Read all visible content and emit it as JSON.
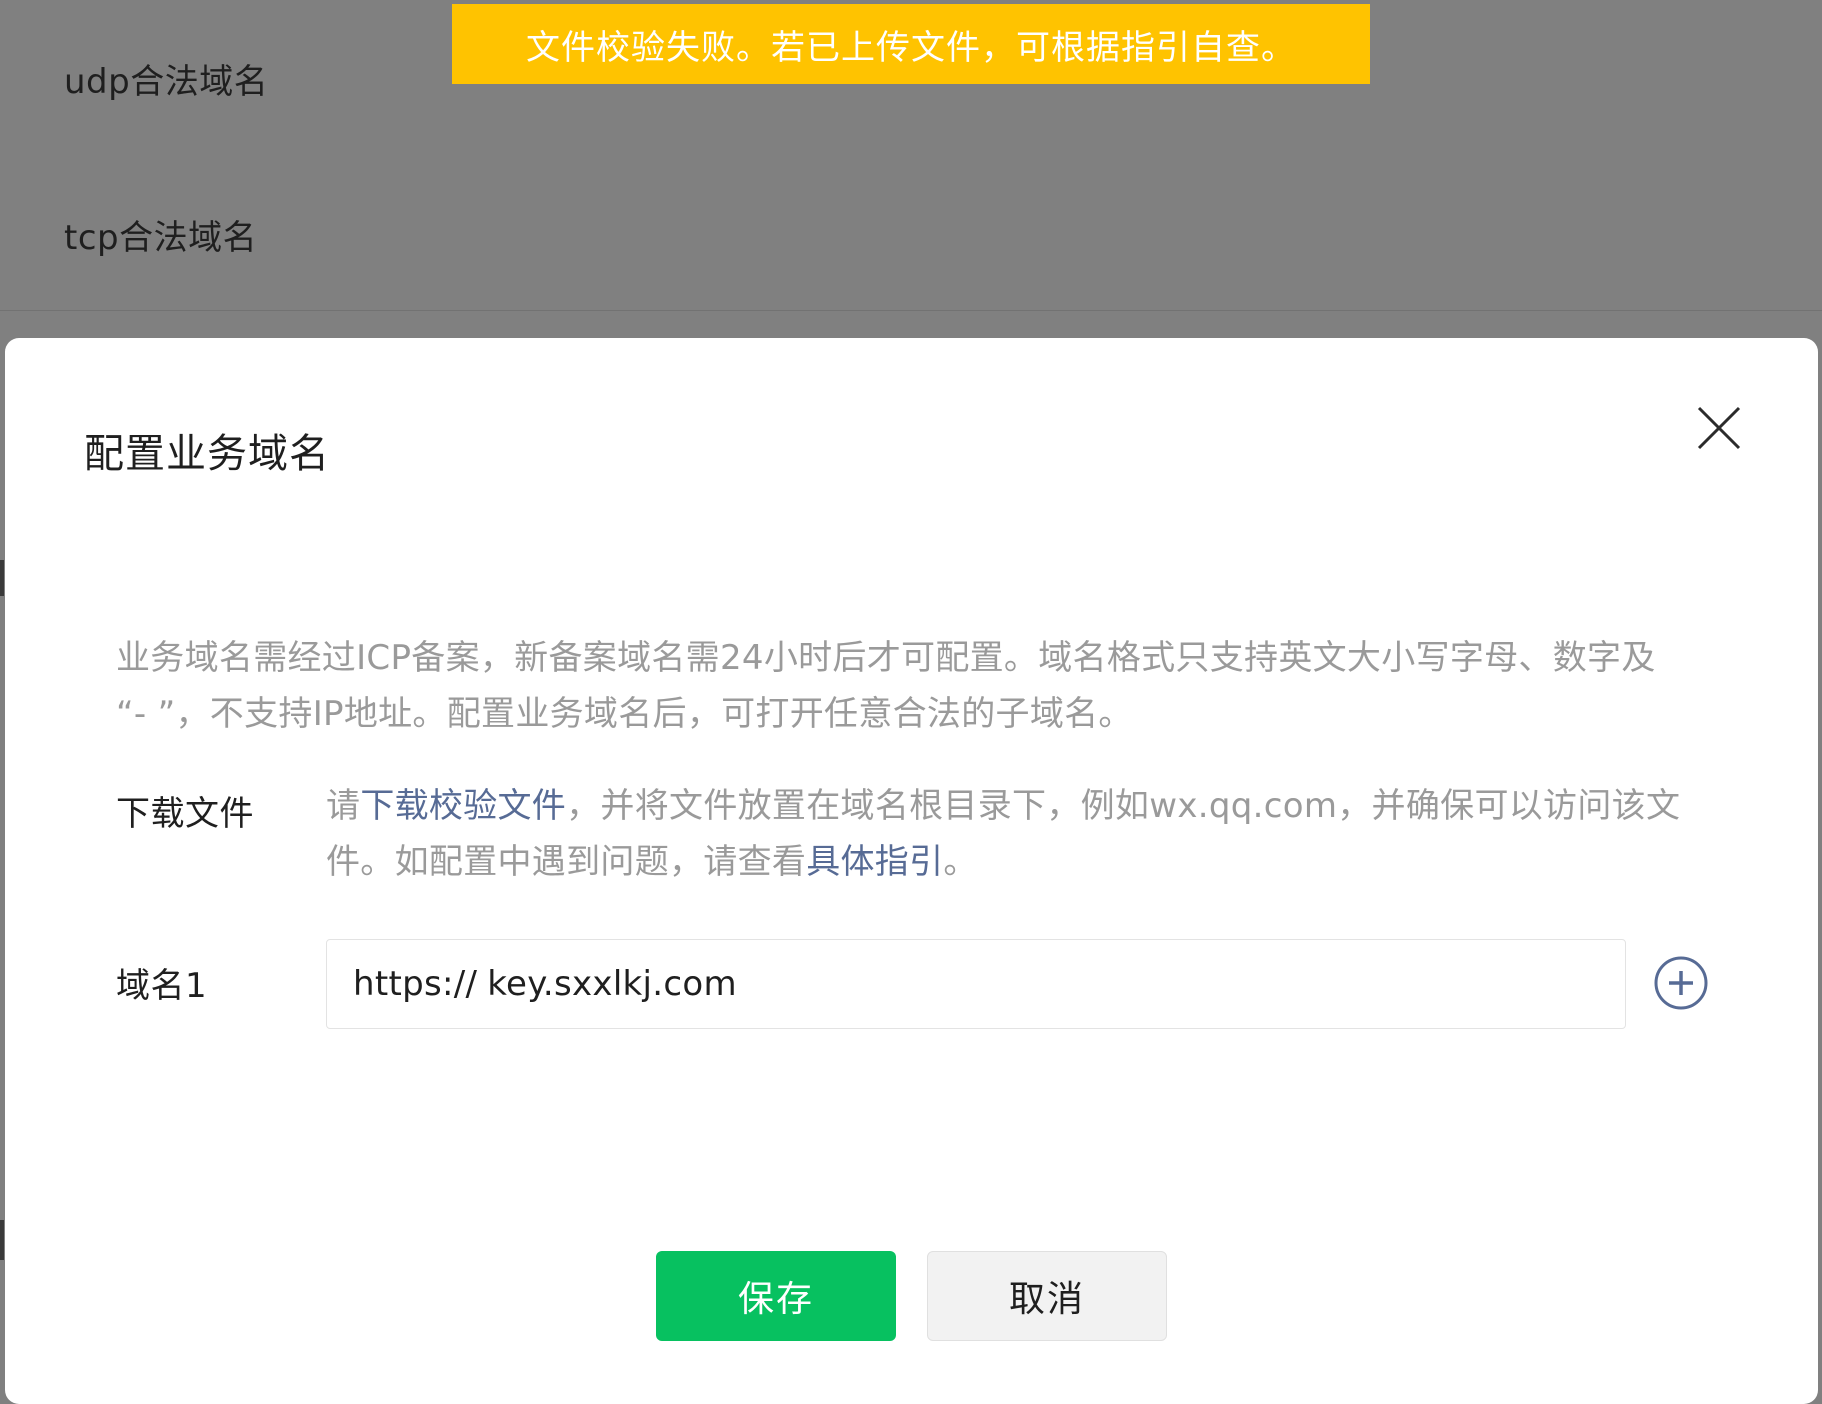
{
  "background": {
    "rows": [
      {
        "label": "udp合法域名"
      },
      {
        "label": "tcp合法域名"
      }
    ]
  },
  "toast": {
    "message": "文件校验失败。若已上传文件，可根据指引自查。",
    "color": "#ffc300"
  },
  "modal": {
    "title": "配置业务域名",
    "close_icon": "close-icon",
    "notice_line1": "业务域名需经过ICP备案，新备案域名需24小时后才可配置。域名格式只支持英文大小写字母、数字及",
    "notice_line2": "“- ”，不支持IP地址。配置业务域名后，可打开任意合法的子域名。",
    "download": {
      "label": "下载文件",
      "text_before": "请",
      "link_download": "下载校验文件",
      "text_middle": "，并将文件放置在域名根目录下，例如wx.qq.com，并确保可以访问该文件。如配置中遇到问题，请查看",
      "link_guide": "具体指引",
      "text_end": "。",
      "link_color": "#576b95"
    },
    "domain_field": {
      "label": "域名1",
      "prefix": "https://",
      "value": "key.sxxlkj.com",
      "add_icon": "plus-circle-icon"
    },
    "buttons": {
      "save_label": "保存",
      "cancel_label": "取消",
      "save_color": "#07c160"
    }
  }
}
